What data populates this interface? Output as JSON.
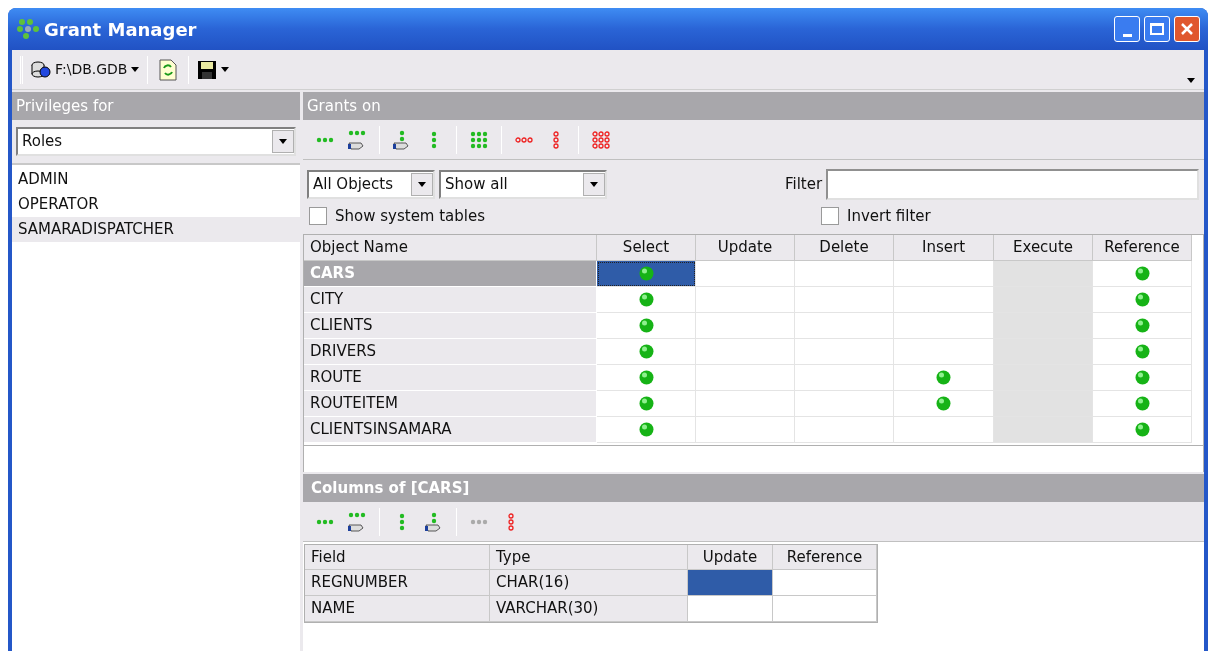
{
  "window": {
    "title": "Grant Manager"
  },
  "toolbar": {
    "database": "F:\\DB.GDB"
  },
  "privileges": {
    "header": "Privileges for",
    "type": "Roles",
    "items": [
      {
        "name": "ADMIN",
        "selected": false
      },
      {
        "name": "OPERATOR",
        "selected": false
      },
      {
        "name": "SAMARADISPATCHER",
        "selected": true
      }
    ]
  },
  "grants": {
    "header": "Grants on",
    "tools": [
      {
        "kind": "grant-row",
        "disabled": false
      },
      {
        "kind": "grant-row-hand",
        "disabled": false
      },
      {
        "kind": "grant-column-hand",
        "disabled": false
      },
      {
        "kind": "grant-column",
        "disabled": false
      },
      {
        "kind": "grant-all",
        "disabled": false
      },
      {
        "kind": "revoke-row",
        "disabled": false
      },
      {
        "kind": "revoke-column",
        "disabled": false
      },
      {
        "kind": "revoke-all",
        "disabled": false
      }
    ],
    "object_type": "All Objects",
    "show": "Show all",
    "filter_label": "Filter",
    "show_system_tables": {
      "label": "Show system tables",
      "checked": false
    },
    "invert_filter": {
      "label": "Invert filter",
      "checked": false
    },
    "columns": [
      "Object Name",
      "Select",
      "Update",
      "Delete",
      "Insert",
      "Execute",
      "Reference"
    ],
    "rows": [
      {
        "name": "CARS",
        "selected": true,
        "cells": [
          {
            "granted": true,
            "selected": true,
            "disabled": false
          },
          {
            "granted": false,
            "selected": false,
            "disabled": false
          },
          {
            "granted": false,
            "selected": false,
            "disabled": false
          },
          {
            "granted": false,
            "selected": false,
            "disabled": false
          },
          {
            "granted": false,
            "selected": false,
            "disabled": true
          },
          {
            "granted": true,
            "selected": false,
            "disabled": false
          }
        ]
      },
      {
        "name": "CITY",
        "selected": false,
        "cells": [
          {
            "granted": true,
            "selected": false,
            "disabled": false
          },
          {
            "granted": false,
            "selected": false,
            "disabled": false
          },
          {
            "granted": false,
            "selected": false,
            "disabled": false
          },
          {
            "granted": false,
            "selected": false,
            "disabled": false
          },
          {
            "granted": false,
            "selected": false,
            "disabled": true
          },
          {
            "granted": true,
            "selected": false,
            "disabled": false
          }
        ]
      },
      {
        "name": "CLIENTS",
        "selected": false,
        "cells": [
          {
            "granted": true,
            "selected": false,
            "disabled": false
          },
          {
            "granted": false,
            "selected": false,
            "disabled": false
          },
          {
            "granted": false,
            "selected": false,
            "disabled": false
          },
          {
            "granted": false,
            "selected": false,
            "disabled": false
          },
          {
            "granted": false,
            "selected": false,
            "disabled": true
          },
          {
            "granted": true,
            "selected": false,
            "disabled": false
          }
        ]
      },
      {
        "name": "DRIVERS",
        "selected": false,
        "cells": [
          {
            "granted": true,
            "selected": false,
            "disabled": false
          },
          {
            "granted": false,
            "selected": false,
            "disabled": false
          },
          {
            "granted": false,
            "selected": false,
            "disabled": false
          },
          {
            "granted": false,
            "selected": false,
            "disabled": false
          },
          {
            "granted": false,
            "selected": false,
            "disabled": true
          },
          {
            "granted": true,
            "selected": false,
            "disabled": false
          }
        ]
      },
      {
        "name": "ROUTE",
        "selected": false,
        "cells": [
          {
            "granted": true,
            "selected": false,
            "disabled": false
          },
          {
            "granted": false,
            "selected": false,
            "disabled": false
          },
          {
            "granted": false,
            "selected": false,
            "disabled": false
          },
          {
            "granted": true,
            "selected": false,
            "disabled": false
          },
          {
            "granted": false,
            "selected": false,
            "disabled": true
          },
          {
            "granted": true,
            "selected": false,
            "disabled": false
          }
        ]
      },
      {
        "name": "ROUTEITEM",
        "selected": false,
        "cells": [
          {
            "granted": true,
            "selected": false,
            "disabled": false
          },
          {
            "granted": false,
            "selected": false,
            "disabled": false
          },
          {
            "granted": false,
            "selected": false,
            "disabled": false
          },
          {
            "granted": true,
            "selected": false,
            "disabled": false
          },
          {
            "granted": false,
            "selected": false,
            "disabled": true
          },
          {
            "granted": true,
            "selected": false,
            "disabled": false
          }
        ]
      },
      {
        "name": "CLIENTSINSAMARA",
        "selected": false,
        "cells": [
          {
            "granted": true,
            "selected": false,
            "disabled": false
          },
          {
            "granted": false,
            "selected": false,
            "disabled": false
          },
          {
            "granted": false,
            "selected": false,
            "disabled": false
          },
          {
            "granted": false,
            "selected": false,
            "disabled": false
          },
          {
            "granted": false,
            "selected": false,
            "disabled": true
          },
          {
            "granted": true,
            "selected": false,
            "disabled": false
          }
        ]
      }
    ]
  },
  "columns_of": {
    "header": "Columns of [CARS]",
    "tools": [
      {
        "kind": "grant-row",
        "disabled": false
      },
      {
        "kind": "grant-row-hand",
        "disabled": false
      },
      {
        "kind": "grant-column",
        "disabled": false
      },
      {
        "kind": "grant-column-hand",
        "disabled": false
      },
      {
        "kind": "grant-row",
        "disabled": true
      },
      {
        "kind": "revoke-column",
        "disabled": false
      }
    ],
    "columns": [
      "Field",
      "Type",
      "Update",
      "Reference"
    ],
    "rows": [
      {
        "field": "REGNUMBER",
        "type": "CHAR(16)",
        "cells": [
          {
            "granted": false,
            "selected": true
          },
          {
            "granted": false,
            "selected": false
          }
        ]
      },
      {
        "field": "NAME",
        "type": "VARCHAR(30)",
        "cells": [
          {
            "granted": false,
            "selected": false
          },
          {
            "granted": false,
            "selected": false
          }
        ]
      }
    ]
  }
}
